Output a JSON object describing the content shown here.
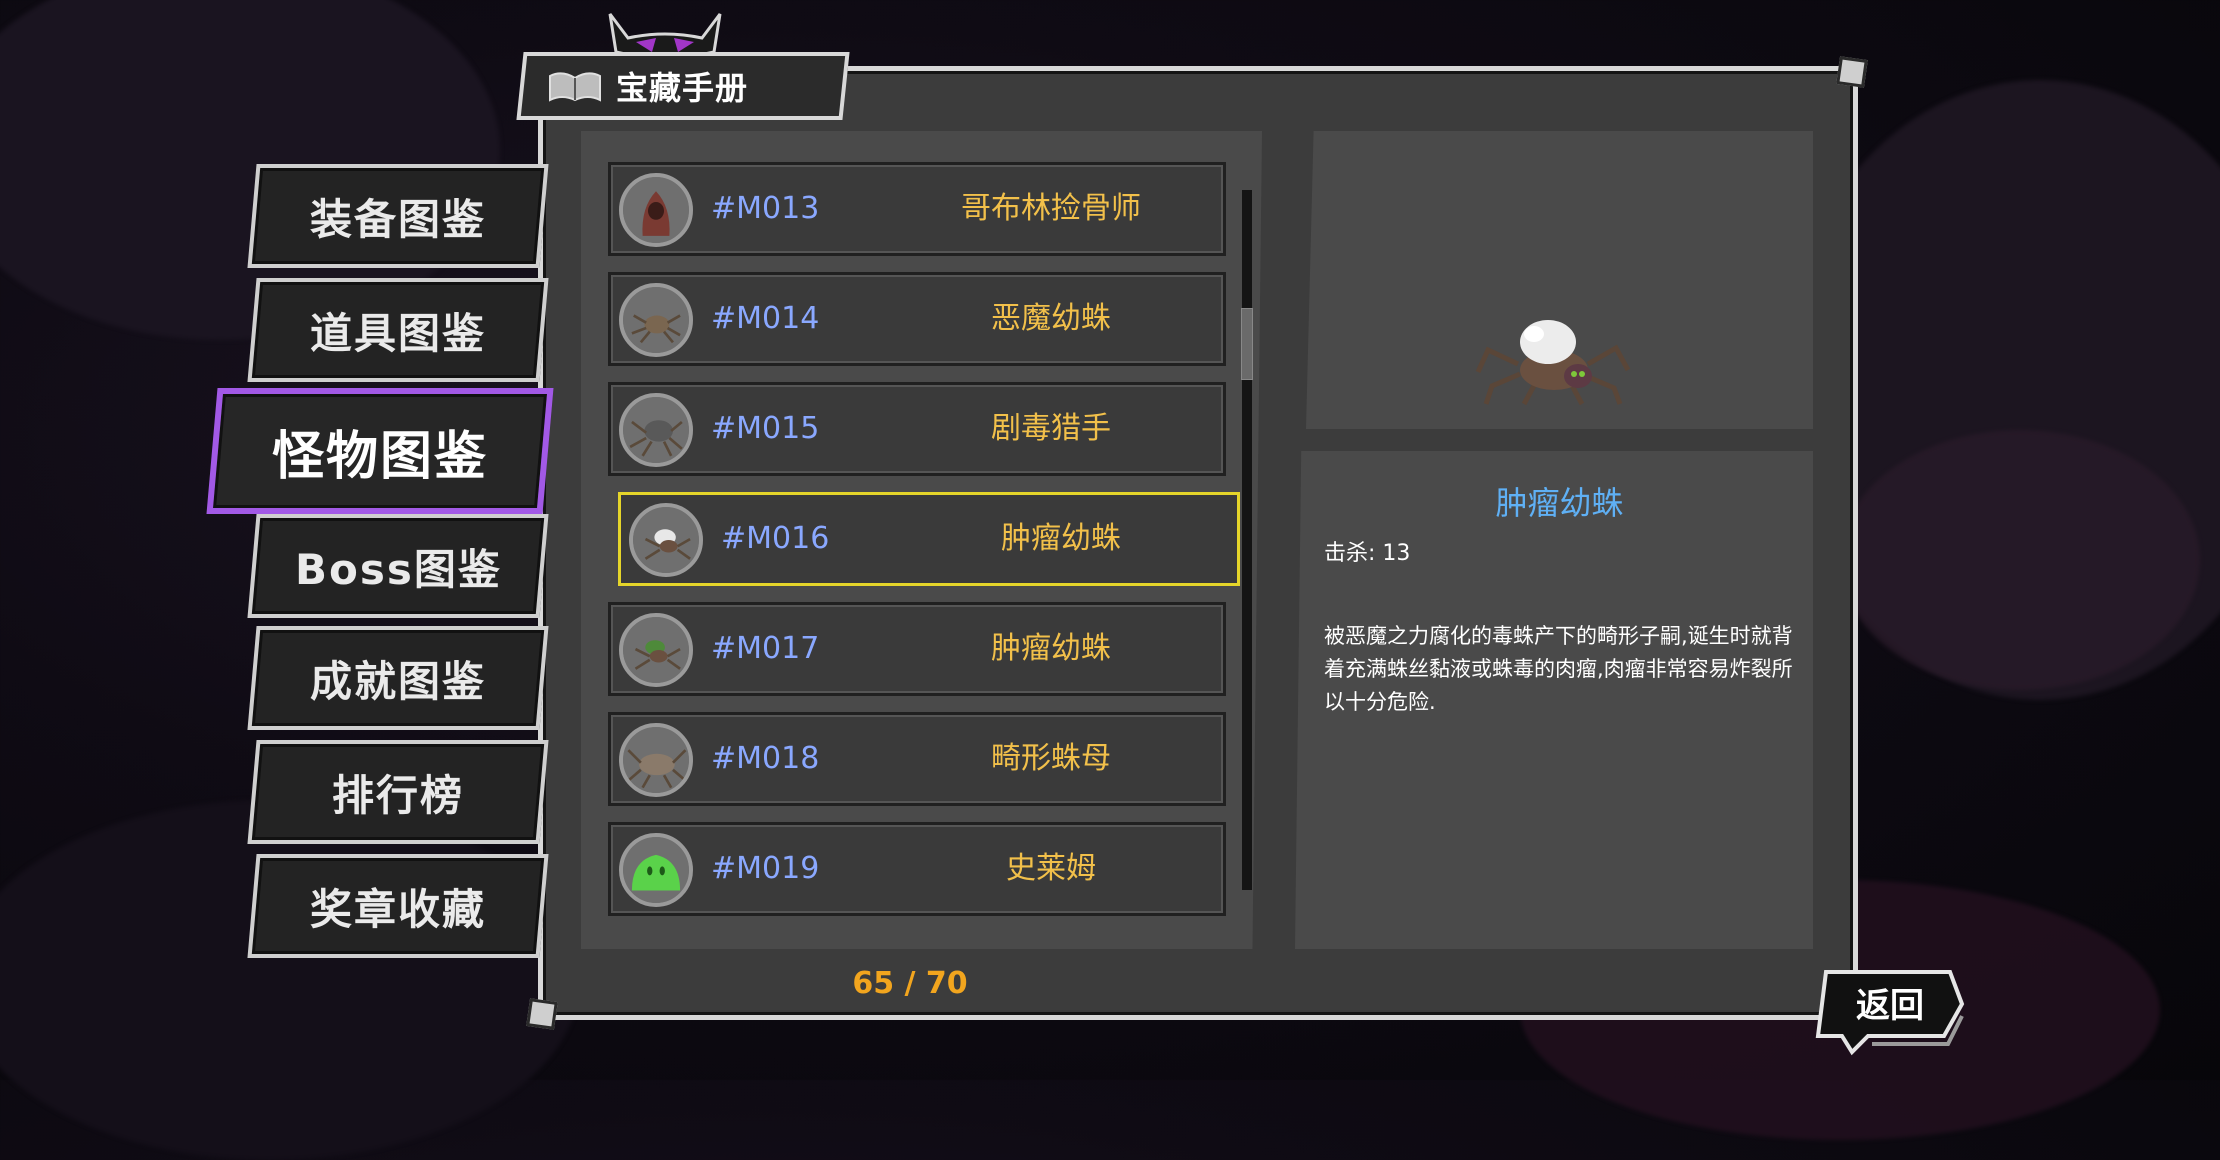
{
  "title": "宝藏手册",
  "menu": [
    {
      "label": "装备图鉴",
      "active": false
    },
    {
      "label": "道具图鉴",
      "active": false
    },
    {
      "label": "怪物图鉴",
      "active": true
    },
    {
      "label": "Boss图鉴",
      "active": false
    },
    {
      "label": "成就图鉴",
      "active": false
    },
    {
      "label": "排行榜",
      "active": false
    },
    {
      "label": "奖章收藏",
      "active": false
    }
  ],
  "list": [
    {
      "id": "#M013",
      "name": "哥布林捡骨师",
      "icon": "goblin-icon"
    },
    {
      "id": "#M014",
      "name": "恶魔幼蛛",
      "icon": "spider-icon"
    },
    {
      "id": "#M015",
      "name": "剧毒猎手",
      "icon": "spider-icon"
    },
    {
      "id": "#M016",
      "name": "肿瘤幼蛛",
      "icon": "spider-icon",
      "selected": true
    },
    {
      "id": "#M017",
      "name": "肿瘤幼蛛",
      "icon": "spider-icon"
    },
    {
      "id": "#M018",
      "name": "畸形蛛母",
      "icon": "spider-icon"
    },
    {
      "id": "#M019",
      "name": "史莱姆",
      "icon": "slime-icon"
    }
  ],
  "counter": "65 / 70",
  "detail": {
    "name": "肿瘤幼蛛",
    "kills": "击杀: 13",
    "description": "被恶魔之力腐化的毒蛛产下的畸形子嗣,诞生时就背着充满蛛丝黏液或蛛毒的肉瘤,肉瘤非常容易炸裂所以十分危险."
  },
  "back_label": "返回",
  "colors": {
    "accent": "#a259e6",
    "id": "#8aa8ff",
    "name": "#f2c04a",
    "detail_title": "#5fb0f5",
    "counter": "#f2a51e",
    "selected_border": "#e5d52a"
  }
}
